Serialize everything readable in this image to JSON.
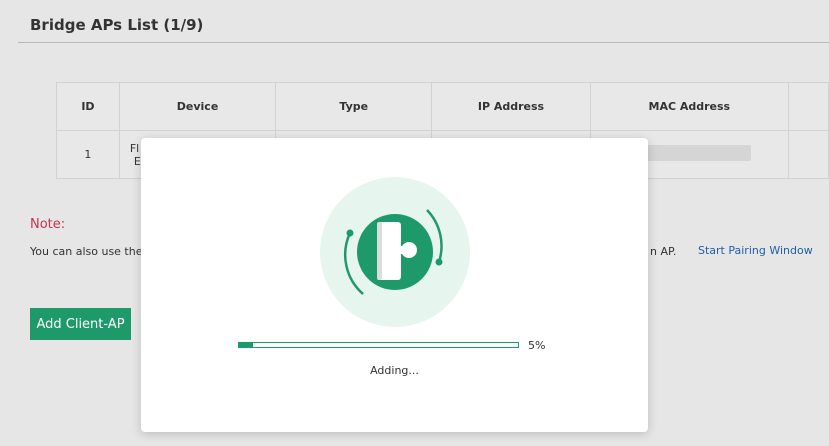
{
  "page": {
    "title": "Bridge APs List (1/9)"
  },
  "table": {
    "headers": [
      "ID",
      "Device",
      "Type",
      "IP Address",
      "MAC Address",
      ""
    ],
    "rows": [
      {
        "id": "1",
        "device_line1": "Fl",
        "device_line2": "E"
      }
    ]
  },
  "note": {
    "label": "Note:",
    "text": "You can also use the",
    "suffix": "n AP.",
    "link": "Start Pairing Window"
  },
  "add_button": {
    "label": "Add Client-AP"
  },
  "modal": {
    "progress": 5,
    "progress_label": "5%",
    "status": "Adding..."
  },
  "colors": {
    "accent": "#1e9a6a",
    "illustration_bg": "#e6f5ee",
    "note": "#c8334a",
    "link": "#1f5fa8"
  },
  "icons": [
    "access-point-icon",
    "wifi-arc-left-icon",
    "wifi-arc-right-icon"
  ]
}
